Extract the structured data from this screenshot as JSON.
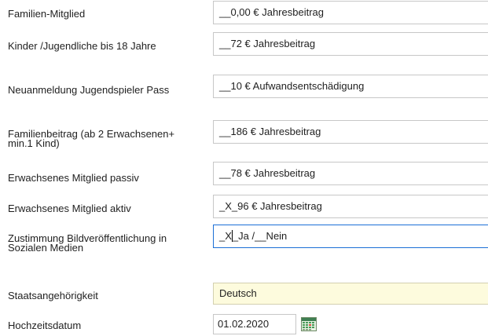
{
  "rows": [
    {
      "label": "Familien-Mitglied",
      "value": "__0,00 € Jahresbeitrag"
    },
    {
      "label": "Kinder /Jugendliche bis 18 Jahre",
      "value": "__72 € Jahresbeitrag"
    },
    {
      "label": "Neuanmeldung Jugendspieler Pass",
      "value": "__10 € Aufwandsentschädigung"
    },
    {
      "label": "Familienbeitrag (ab 2 Erwachsenen+ min.1 Kind)",
      "value": "__186 € Jahresbeitrag"
    },
    {
      "label": "Erwachsenes Mitglied passiv",
      "value": "__78 € Jahresbeitrag"
    },
    {
      "label": "Erwachsenes Mitglied aktiv",
      "value": "_X_96 € Jahresbeitrag"
    },
    {
      "label": "Zustimmung Bildveröffentlichung in Sozialen Medien",
      "value_before_caret": "_X",
      "value_after_caret": "_Ja /__Nein"
    },
    {
      "label": "Staatsangehörigkeit",
      "value": "Deutsch"
    },
    {
      "label": "Hochzeitsdatum",
      "value": "01.02.2020"
    }
  ],
  "icons": {
    "calendar": "calendar-icon"
  },
  "colors": {
    "focus_border": "#1b6fd6",
    "highlight_bg": "#fdfbdd",
    "field_border": "#c7c7c7"
  }
}
